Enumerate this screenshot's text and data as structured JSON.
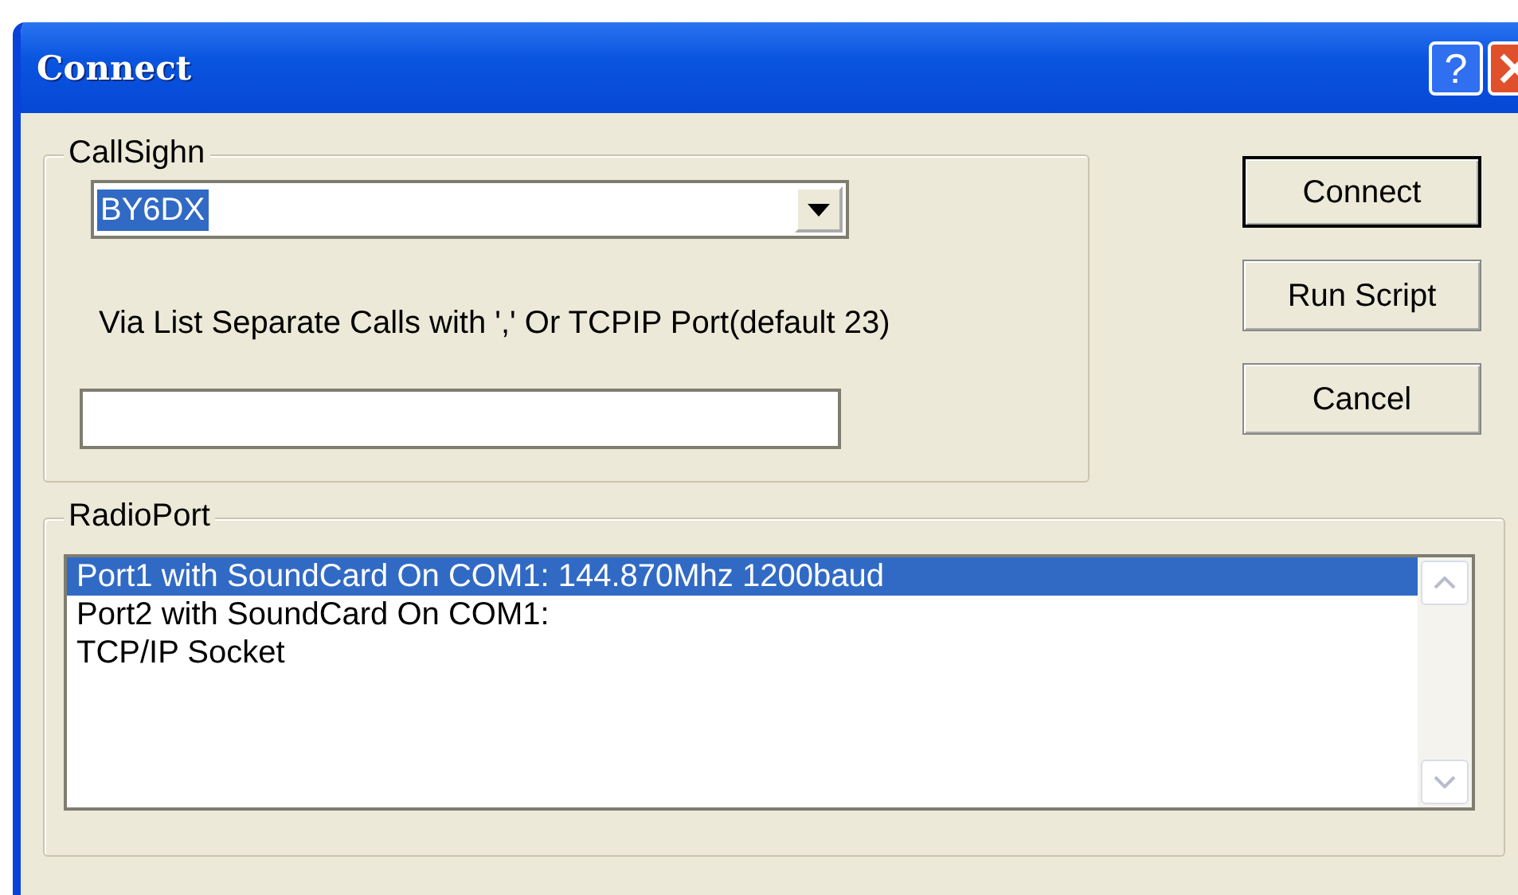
{
  "window": {
    "title": "Connect",
    "help_button": "?"
  },
  "callsign_group": {
    "label": "CallSighn",
    "combo_value": "BY6DX",
    "via_label": "Via List Separate Calls with ',' Or TCPIP Port(default 23)"
  },
  "buttons": [
    {
      "label": "Connect",
      "default": true
    },
    {
      "label": "Run Script",
      "default": false
    },
    {
      "label": "Cancel",
      "default": false
    }
  ],
  "radioport_group": {
    "label": "RadioPort",
    "items": [
      {
        "label": "Port1 with SoundCard On COM1: 144.870Mhz 1200baud",
        "selected": true
      },
      {
        "label": "Port2 with SoundCard On COM1:",
        "selected": false
      },
      {
        "label": "TCP/IP Socket",
        "selected": false
      }
    ]
  }
}
